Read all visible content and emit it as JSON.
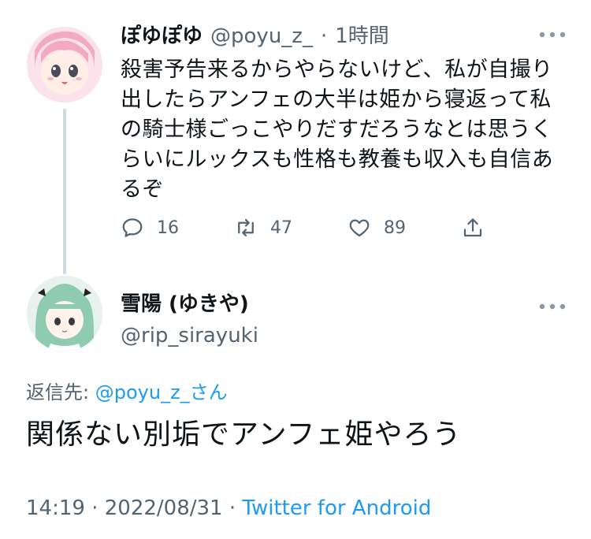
{
  "parent_tweet": {
    "display_name": "ぽゆぽゆ",
    "handle": "@poyu_z_",
    "separator": "·",
    "time": "1時間",
    "body": "殺害予告来るからやらないけど、私が自撮り出したらアンフェの大半は姫から寝返って私の騎士様ごっこやりだすだろうなとは思うくらいにルックスも性格も教養も収入も自信あるぞ",
    "actions": {
      "reply_count": "16",
      "retweet_count": "47",
      "like_count": "89"
    },
    "more_icon": "ellipsis-icon"
  },
  "reply_tweet": {
    "display_name": "雪陽 (ゆきや)",
    "handle": "@rip_sirayuki",
    "reply_to_label": "返信先:",
    "reply_to_mention": "@poyu_z_さん",
    "body": "関係ない別垢でアンフェ姫やろう",
    "time": "14:19",
    "date": "2022/08/31",
    "separator": "·",
    "client": "Twitter for Android",
    "more_icon": "ellipsis-icon"
  },
  "colors": {
    "accent": "#1d9bf0",
    "secondary_text": "#536471",
    "thread_line": "#cfd9de"
  }
}
